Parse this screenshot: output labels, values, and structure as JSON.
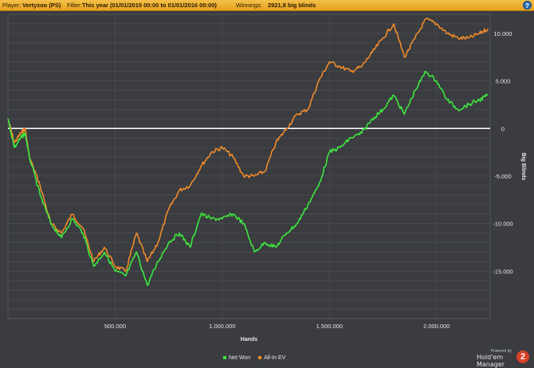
{
  "header": {
    "player_label": "Player:",
    "player_value": "Vertyzoo (PS)",
    "filter_label": "Filter:",
    "filter_value": "This year (01/01/2015 00:00 to 01/01/2016 00:00)",
    "winnings_label": "Winnings:",
    "winnings_value": "2921,8 big blinds",
    "help_icon": "?"
  },
  "branding": {
    "powered_by": "Powered by",
    "name": "Hold'em Manager",
    "logo_text": "2"
  },
  "colors": {
    "background": "#3a3c40",
    "grid": "#4a4d52",
    "zero_line": "#ffffff",
    "net_won": "#3ee63e",
    "all_in_ev": "#ef8a2a",
    "axis_text": "#e6e6e6"
  },
  "chart_data": {
    "type": "line",
    "title": "",
    "xlabel": "Hands",
    "ylabel": "Big Blinds",
    "xlim": [
      0,
      2250000
    ],
    "ylim": [
      -20000,
      12000
    ],
    "x_ticks": [
      500000,
      1000000,
      1500000,
      2000000
    ],
    "x_tick_labels": [
      "500.000",
      "1.000.000",
      "1.500.000",
      "2.000.000"
    ],
    "y_ticks": [
      10000,
      5000,
      0,
      -5000,
      -10000,
      -15000
    ],
    "y_tick_labels": [
      "10.000",
      "5.000",
      "0",
      "-5.000",
      "-10.000",
      "-15.000"
    ],
    "y_axis_side": "right",
    "grid": true,
    "legend_position": "bottom",
    "x": [
      0,
      30000,
      60000,
      80000,
      100000,
      150000,
      200000,
      250000,
      300000,
      350000,
      400000,
      450000,
      500000,
      550000,
      600000,
      650000,
      700000,
      750000,
      800000,
      850000,
      900000,
      950000,
      1000000,
      1050000,
      1100000,
      1150000,
      1200000,
      1250000,
      1300000,
      1350000,
      1400000,
      1450000,
      1500000,
      1550000,
      1600000,
      1650000,
      1700000,
      1750000,
      1800000,
      1850000,
      1900000,
      1950000,
      2000000,
      2050000,
      2100000,
      2150000,
      2200000,
      2240000
    ],
    "series": [
      {
        "name": "Net Won",
        "color": "#3ee63e",
        "values": [
          1000,
          -2000,
          -1000,
          -500,
          -3000,
          -7000,
          -10000,
          -11500,
          -9500,
          -11000,
          -14500,
          -13000,
          -15000,
          -15500,
          -13000,
          -16500,
          -14000,
          -12000,
          -11000,
          -12500,
          -9000,
          -9500,
          -9500,
          -9000,
          -10000,
          -13000,
          -12000,
          -12500,
          -11000,
          -10000,
          -8000,
          -6000,
          -2500,
          -2000,
          -1000,
          -500,
          1000,
          2000,
          3500,
          1500,
          4000,
          6000,
          5000,
          3000,
          2000,
          2500,
          3000,
          3500
        ]
      },
      {
        "name": "All-In EV",
        "color": "#ef8a2a",
        "values": [
          1000,
          -1500,
          -500,
          0,
          -3000,
          -6000,
          -10000,
          -11000,
          -9000,
          -10500,
          -14000,
          -12500,
          -14500,
          -15000,
          -11000,
          -14000,
          -12000,
          -8500,
          -6500,
          -6000,
          -4000,
          -2500,
          -2000,
          -3000,
          -5000,
          -5000,
          -4500,
          -1500,
          0,
          1500,
          2000,
          5000,
          7000,
          6500,
          6000,
          6500,
          8000,
          9500,
          11000,
          7500,
          9500,
          11500,
          11000,
          10000,
          9500,
          9500,
          10000,
          10500
        ]
      }
    ]
  }
}
